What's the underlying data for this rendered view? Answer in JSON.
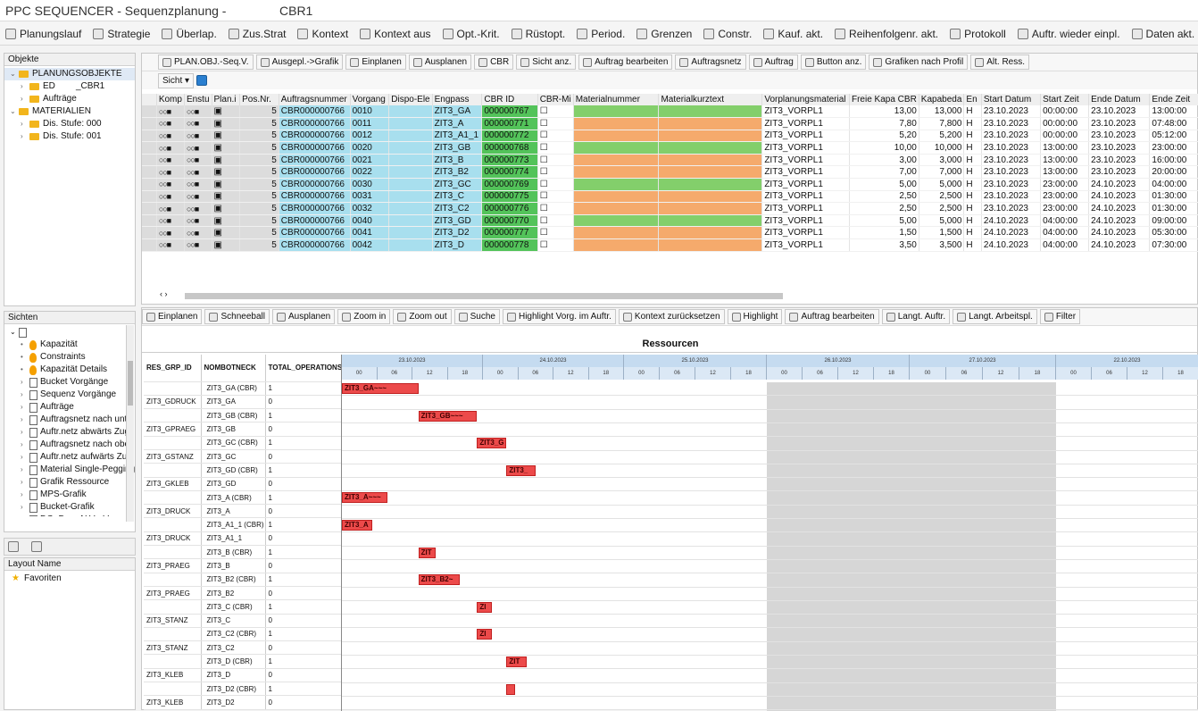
{
  "window": {
    "title": "PPC SEQUENCER - Sequenzplanung -",
    "subtitle": "CBR1"
  },
  "toolbar": [
    {
      "label": "Planungslauf",
      "icon": "wand-icon"
    },
    {
      "label": "Strategie",
      "icon": "strategy-icon"
    },
    {
      "label": "Überlap.",
      "icon": "grid-icon"
    },
    {
      "label": "Zus.Strat",
      "icon": "folder-icon"
    },
    {
      "label": "Kontext",
      "icon": "filter-icon"
    },
    {
      "label": "Kontext aus",
      "icon": "filter-off-icon"
    },
    {
      "label": "Opt.-Krit.",
      "icon": "criteria-icon"
    },
    {
      "label": "Rüstopt.",
      "icon": "wand-icon"
    },
    {
      "label": "Period.",
      "icon": "period-icon"
    },
    {
      "label": "Grenzen",
      "icon": "limits-icon"
    },
    {
      "label": "Constr.",
      "icon": "grid-icon"
    },
    {
      "label": "Kauf. akt.",
      "icon": "buy-icon"
    },
    {
      "label": "Reihenfolgenr. akt.",
      "icon": "sequence-icon"
    },
    {
      "label": "Protokoll",
      "icon": "log-icon"
    },
    {
      "label": "Auftr. wieder einpl.",
      "icon": "replan-icon"
    },
    {
      "label": "Daten akt.",
      "icon": "refresh-icon"
    }
  ],
  "objects_panel": {
    "header": "Objekte",
    "items": [
      {
        "label": "PLANUNGSOBJEKTE",
        "level": 0
      },
      {
        "label": "ED",
        "extra": "_CBR1",
        "level": 1
      },
      {
        "label": "Aufträge",
        "level": 1
      },
      {
        "label": "MATERIALIEN",
        "level": 0
      },
      {
        "label": "Dis. Stufe: 000",
        "level": 1
      },
      {
        "label": "Dis. Stufe: 001",
        "level": 1
      }
    ]
  },
  "views_panel": {
    "header": "Sichten",
    "items": [
      "Kapazität",
      "Constraints",
      "Kapazität Details",
      "Bucket Vorgänge",
      "Sequenz Vorgänge",
      "Aufträge",
      "Auftragsnetz nach unte",
      "Auftr.netz abwärts Zug",
      "Auftragsnetz nach obe",
      "Auftr.netz aufwärts Zu",
      "Material Single-Pegging",
      "Grafik Ressource",
      "MPS-Grafik",
      "Bucket-Grafik",
      "DG: Dyn. ALV - Vor"
    ]
  },
  "layout_panel": {
    "header": "Layout Name",
    "favorites": "Favoriten"
  },
  "grid_toolbar": [
    "PLAN.OBJ.-Seq.V.",
    "Ausgepl.->Grafik",
    "Einplanen",
    "Ausplanen",
    "CBR",
    "Sicht anz.",
    "Auftrag bearbeiten",
    "Auftragsnetz",
    "Auftrag",
    "Button anz.",
    "Grafiken nach Profil",
    "Alt. Ress."
  ],
  "grid_view_label": "Sicht",
  "grid": {
    "columns": [
      "Komp",
      "Enstu",
      "Plan.i",
      "Pos.Nr.",
      "Auftragsnummer",
      "Vorgang",
      "Dispo-Ele",
      "Engpass",
      "CBR ID",
      "CBR-Mi",
      "Materialnummer",
      "Materialkurztext",
      "Vorplanungsmaterial",
      "Freie Kapa CBR",
      "Kapabeda",
      "En",
      "Start Datum",
      "Start Zeit",
      "Ende Datum",
      "Ende Zeit"
    ],
    "rows": [
      {
        "pos": "5",
        "order": "CBR000000766",
        "op": "0010",
        "eng": "ZIT3_GA",
        "cbr": "000000767",
        "mat": "green",
        "vm": "ZIT3_VORPL1",
        "free": "13,00",
        "kapa": "13,000",
        "en": "H",
        "sd": "23.10.2023",
        "st": "00:00:00",
        "ed": "23.10.2023",
        "et": "13:00:00"
      },
      {
        "pos": "5",
        "order": "CBR000000766",
        "op": "0011",
        "eng": "ZIT3_A",
        "cbr": "000000771",
        "mat": "orange",
        "vm": "ZIT3_VORPL1",
        "free": "7,80",
        "kapa": "7,800",
        "en": "H",
        "sd": "23.10.2023",
        "st": "00:00:00",
        "ed": "23.10.2023",
        "et": "07:48:00"
      },
      {
        "pos": "5",
        "order": "CBR000000766",
        "op": "0012",
        "eng": "ZIT3_A1_1",
        "cbr": "000000772",
        "mat": "orange",
        "vm": "ZIT3_VORPL1",
        "free": "5,20",
        "kapa": "5,200",
        "en": "H",
        "sd": "23.10.2023",
        "st": "00:00:00",
        "ed": "23.10.2023",
        "et": "05:12:00"
      },
      {
        "pos": "5",
        "order": "CBR000000766",
        "op": "0020",
        "eng": "ZIT3_GB",
        "cbr": "000000768",
        "mat": "green",
        "vm": "ZIT3_VORPL1",
        "free": "10,00",
        "kapa": "10,000",
        "en": "H",
        "sd": "23.10.2023",
        "st": "13:00:00",
        "ed": "23.10.2023",
        "et": "23:00:00"
      },
      {
        "pos": "5",
        "order": "CBR000000766",
        "op": "0021",
        "eng": "ZIT3_B",
        "cbr": "000000773",
        "mat": "orange",
        "vm": "ZIT3_VORPL1",
        "free": "3,00",
        "kapa": "3,000",
        "en": "H",
        "sd": "23.10.2023",
        "st": "13:00:00",
        "ed": "23.10.2023",
        "et": "16:00:00"
      },
      {
        "pos": "5",
        "order": "CBR000000766",
        "op": "0022",
        "eng": "ZIT3_B2",
        "cbr": "000000774",
        "mat": "orange",
        "vm": "ZIT3_VORPL1",
        "free": "7,00",
        "kapa": "7,000",
        "en": "H",
        "sd": "23.10.2023",
        "st": "13:00:00",
        "ed": "23.10.2023",
        "et": "20:00:00"
      },
      {
        "pos": "5",
        "order": "CBR000000766",
        "op": "0030",
        "eng": "ZIT3_GC",
        "cbr": "000000769",
        "mat": "green",
        "vm": "ZIT3_VORPL1",
        "free": "5,00",
        "kapa": "5,000",
        "en": "H",
        "sd": "23.10.2023",
        "st": "23:00:00",
        "ed": "24.10.2023",
        "et": "04:00:00"
      },
      {
        "pos": "5",
        "order": "CBR000000766",
        "op": "0031",
        "eng": "ZIT3_C",
        "cbr": "000000775",
        "mat": "orange",
        "vm": "ZIT3_VORPL1",
        "free": "2,50",
        "kapa": "2,500",
        "en": "H",
        "sd": "23.10.2023",
        "st": "23:00:00",
        "ed": "24.10.2023",
        "et": "01:30:00"
      },
      {
        "pos": "5",
        "order": "CBR000000766",
        "op": "0032",
        "eng": "ZIT3_C2",
        "cbr": "000000776",
        "mat": "orange",
        "vm": "ZIT3_VORPL1",
        "free": "2,50",
        "kapa": "2,500",
        "en": "H",
        "sd": "23.10.2023",
        "st": "23:00:00",
        "ed": "24.10.2023",
        "et": "01:30:00"
      },
      {
        "pos": "5",
        "order": "CBR000000766",
        "op": "0040",
        "eng": "ZIT3_GD",
        "cbr": "000000770",
        "mat": "green",
        "vm": "ZIT3_VORPL1",
        "free": "5,00",
        "kapa": "5,000",
        "en": "H",
        "sd": "24.10.2023",
        "st": "04:00:00",
        "ed": "24.10.2023",
        "et": "09:00:00"
      },
      {
        "pos": "5",
        "order": "CBR000000766",
        "op": "0041",
        "eng": "ZIT3_D2",
        "cbr": "000000777",
        "mat": "orange",
        "vm": "ZIT3_VORPL1",
        "free": "1,50",
        "kapa": "1,500",
        "en": "H",
        "sd": "24.10.2023",
        "st": "04:00:00",
        "ed": "24.10.2023",
        "et": "05:30:00"
      },
      {
        "pos": "5",
        "order": "CBR000000766",
        "op": "0042",
        "eng": "ZIT3_D",
        "cbr": "000000778",
        "mat": "orange",
        "vm": "ZIT3_VORPL1",
        "free": "3,50",
        "kapa": "3,500",
        "en": "H",
        "sd": "24.10.2023",
        "st": "04:00:00",
        "ed": "24.10.2023",
        "et": "07:30:00"
      }
    ]
  },
  "gantt_toolbar": [
    "Einplanen",
    "Schneeball",
    "Ausplanen",
    "Zoom in",
    "Zoom out",
    "Suche",
    "Highlight Vorg. im Auftr.",
    "Kontext zurücksetzen",
    "Highlight",
    "Auftrag bearbeiten",
    "Langt. Auftr.",
    "Langt. Arbeitspl.",
    "Filter"
  ],
  "gantt": {
    "title": "Ressourcen",
    "columns": [
      "RES_GRP_ID",
      "NOMBOTNECK",
      "TOTAL_OPERATIONS"
    ],
    "dates": [
      "23.10.2023",
      "24.10.2023",
      "25.10.2023",
      "26.10.2023",
      "27.10.2023",
      "22.10.2023"
    ],
    "hours": [
      "00",
      "06",
      "12",
      "18"
    ],
    "rows": [
      {
        "grp": "",
        "res": "ZIT3_GA (CBR)",
        "ops": "1",
        "bar": {
          "label": "ZIT3_GA~~~",
          "start": 0,
          "dur": 13
        }
      },
      {
        "grp": "ZIT3_GDRUCK",
        "res": "ZIT3_GA",
        "ops": "0"
      },
      {
        "grp": "",
        "res": "ZIT3_GB (CBR)",
        "ops": "1",
        "bar": {
          "label": "ZIT3_GB~~~",
          "start": 13,
          "dur": 10
        }
      },
      {
        "grp": "ZIT3_GPRAEG",
        "res": "ZIT3_GB",
        "ops": "0"
      },
      {
        "grp": "",
        "res": "ZIT3_GC (CBR)",
        "ops": "1",
        "bar": {
          "label": "ZIT3_G",
          "start": 23,
          "dur": 5
        }
      },
      {
        "grp": "ZIT3_GSTANZ",
        "res": "ZIT3_GC",
        "ops": "0"
      },
      {
        "grp": "",
        "res": "ZIT3_GD (CBR)",
        "ops": "1",
        "bar": {
          "label": "ZIT3_",
          "start": 28,
          "dur": 5
        }
      },
      {
        "grp": "ZIT3_GKLEB",
        "res": "ZIT3_GD",
        "ops": "0"
      },
      {
        "grp": "",
        "res": "ZIT3_A (CBR)",
        "ops": "1",
        "bar": {
          "label": "ZIT3_A~~~",
          "start": 0,
          "dur": 7.8
        }
      },
      {
        "grp": "ZIT3_DRUCK",
        "res": "ZIT3_A",
        "ops": "0"
      },
      {
        "grp": "",
        "res": "ZIT3_A1_1 (CBR)",
        "ops": "1",
        "bar": {
          "label": "ZIT3_A",
          "start": 0,
          "dur": 5.2
        }
      },
      {
        "grp": "ZIT3_DRUCK",
        "res": "ZIT3_A1_1",
        "ops": "0"
      },
      {
        "grp": "",
        "res": "ZIT3_B (CBR)",
        "ops": "1",
        "bar": {
          "label": "ZIT",
          "start": 13,
          "dur": 3
        }
      },
      {
        "grp": "ZIT3_PRAEG",
        "res": "ZIT3_B",
        "ops": "0"
      },
      {
        "grp": "",
        "res": "ZIT3_B2 (CBR)",
        "ops": "1",
        "bar": {
          "label": "ZIT3_B2~",
          "start": 13,
          "dur": 7
        }
      },
      {
        "grp": "ZIT3_PRAEG",
        "res": "ZIT3_B2",
        "ops": "0"
      },
      {
        "grp": "",
        "res": "ZIT3_C (CBR)",
        "ops": "1",
        "bar": {
          "label": "ZI",
          "start": 23,
          "dur": 2.5
        }
      },
      {
        "grp": "ZIT3_STANZ",
        "res": "ZIT3_C",
        "ops": "0"
      },
      {
        "grp": "",
        "res": "ZIT3_C2 (CBR)",
        "ops": "1",
        "bar": {
          "label": "ZI",
          "start": 23,
          "dur": 2.5
        }
      },
      {
        "grp": "ZIT3_STANZ",
        "res": "ZIT3_C2",
        "ops": "0"
      },
      {
        "grp": "",
        "res": "ZIT3_D (CBR)",
        "ops": "1",
        "bar": {
          "label": "ZIT",
          "start": 28,
          "dur": 3.5
        }
      },
      {
        "grp": "ZIT3_KLEB",
        "res": "ZIT3_D",
        "ops": "0"
      },
      {
        "grp": "",
        "res": "ZIT3_D2 (CBR)",
        "ops": "1",
        "bar": {
          "label": "",
          "start": 28,
          "dur": 1.5
        }
      },
      {
        "grp": "ZIT3_KLEB",
        "res": "ZIT3_D2",
        "ops": "0"
      }
    ]
  },
  "colors": {
    "bar": "#ec4a4a",
    "cyan": "#a8dfee",
    "green": "#83cf6b",
    "orange": "#f5aa6c",
    "cbr": "#53c35a",
    "nonworking": "#d6d6d6"
  }
}
